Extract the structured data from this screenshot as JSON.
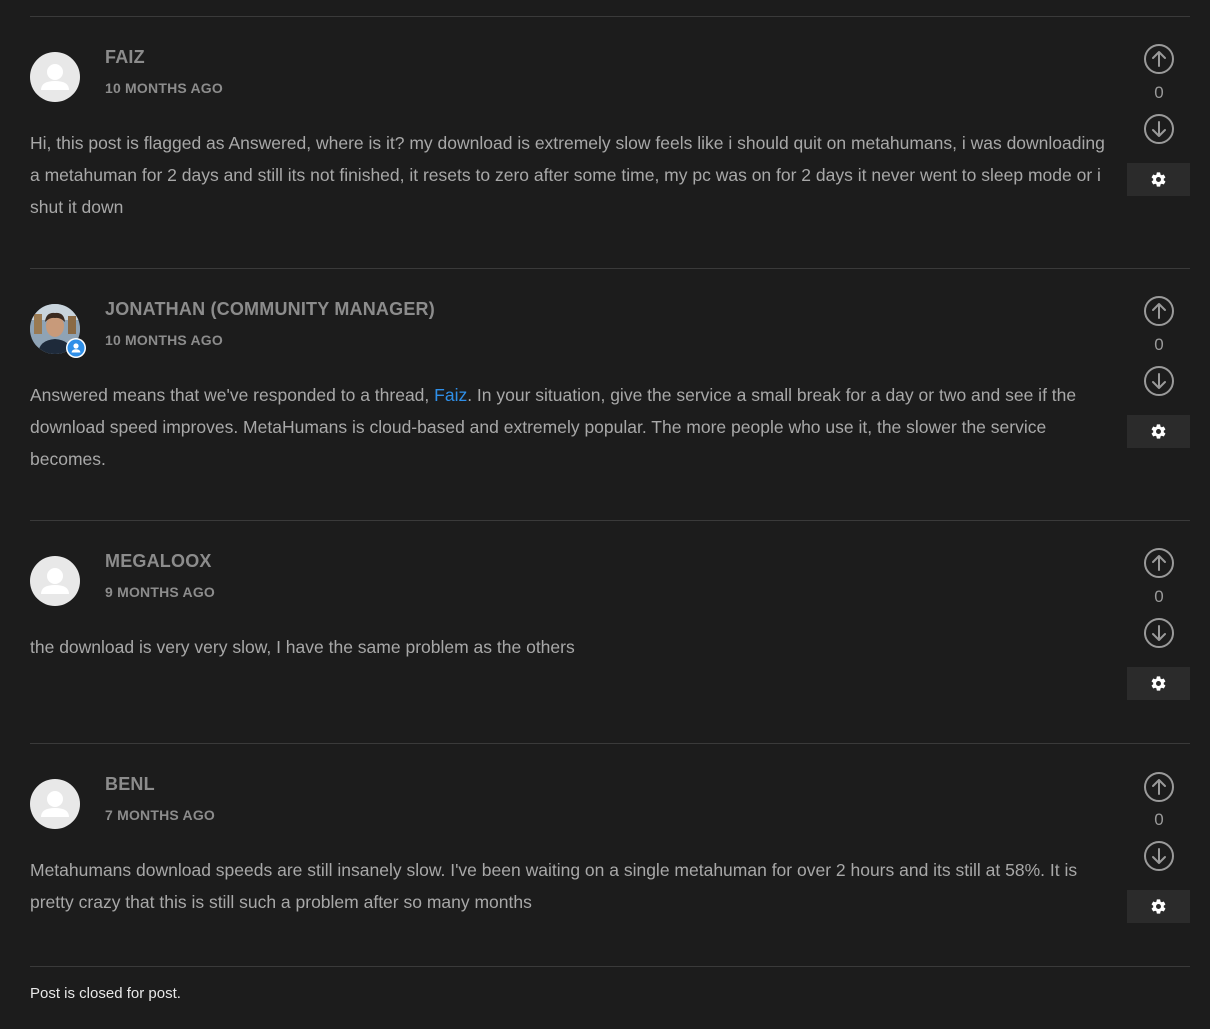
{
  "comments": [
    {
      "author": "FAIZ",
      "time": "10 MONTHS AGO",
      "text": "Hi, this post is flagged as Answered, where is it? my download is extremely slow feels like i should quit on metahumans, i was downloading a metahuman for 2 days and still its not finished, it resets to zero after some time, my pc was on for 2 days it never went to sleep mode or i shut it down",
      "votes": "0",
      "avatar_icon": "default-user-icon"
    },
    {
      "author": "JONATHAN (COMMUNITY MANAGER)",
      "time": "10 MONTHS AGO",
      "text_before": "Answered means that we've responded to a thread, ",
      "mention": "Faiz",
      "text_after": ". In your situation, give the service a small break for a day or two and see if the download speed improves. MetaHumans is cloud-based and extremely popular. The more people who use it, the slower the service becomes.",
      "votes": "0",
      "avatar_icon": "user-photo",
      "badge_icon": "staff-badge-icon"
    },
    {
      "author": "MEGALOOX",
      "time": "9 MONTHS AGO",
      "text": "the download is very very slow, I have the same problem as the others",
      "votes": "0",
      "avatar_icon": "default-user-icon"
    },
    {
      "author": "BENL",
      "time": "7 MONTHS AGO",
      "text": "Metahumans download speeds are still insanely slow. I've been waiting on a single metahuman for over 2 hours and its still at 58%. It is pretty crazy that this is still such a problem after so many months",
      "votes": "0",
      "avatar_icon": "default-user-icon"
    }
  ],
  "footer": {
    "closed_text": "Post is closed for post."
  },
  "colors": {
    "background": "#1c1c1c",
    "text": "#a8a8a8",
    "link": "#2f8fe8",
    "divider": "#3a3a3a"
  }
}
